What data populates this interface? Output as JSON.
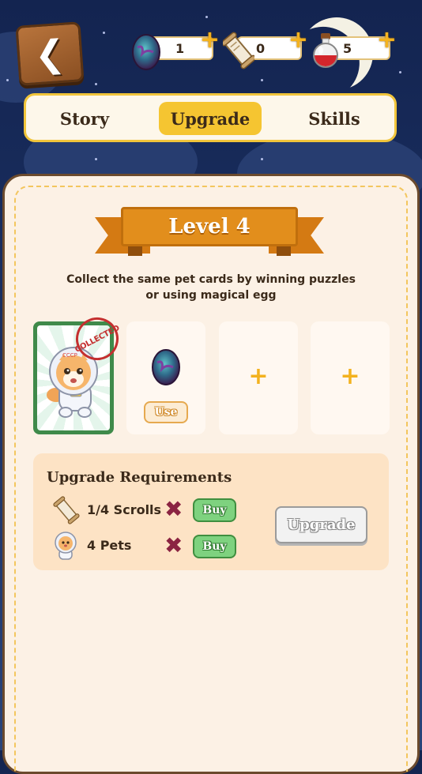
{
  "top_bar": {
    "back_icon": "chevron-left-icon",
    "resources": [
      {
        "icon": "magical-egg-icon",
        "value": "1",
        "plus": "+"
      },
      {
        "icon": "scroll-icon",
        "value": "0",
        "plus": "+"
      },
      {
        "icon": "potion-icon",
        "value": "5",
        "plus": "+"
      }
    ]
  },
  "tabs": [
    {
      "label": "Story",
      "active": false
    },
    {
      "label": "Upgrade",
      "active": true
    },
    {
      "label": "Skills",
      "active": false
    }
  ],
  "level_banner": "Level 4",
  "description": {
    "line1": "Collect the same pet cards by winning puzzles",
    "line2": "or using magical egg"
  },
  "card": {
    "stamp": "COLLECTED",
    "helmet_text": "CCCP"
  },
  "slots": {
    "use_button": "Use",
    "plus": "+"
  },
  "requirements": {
    "title": "Upgrade Requirements",
    "items": [
      {
        "label": "1/4 Scrolls",
        "buy": "Buy",
        "icon": "scroll-icon",
        "status": "not-met"
      },
      {
        "label": "4 Pets",
        "buy": "Buy",
        "icon": "pet-icon",
        "status": "not-met"
      }
    ],
    "upgrade_button": "Upgrade"
  },
  "colors": {
    "accent_yellow": "#f5c531",
    "ribbon_orange": "#e28e1c",
    "buy_green": "#7ed27f",
    "cross_red": "#8b2442",
    "panel_bg": "#fcf1e5"
  }
}
